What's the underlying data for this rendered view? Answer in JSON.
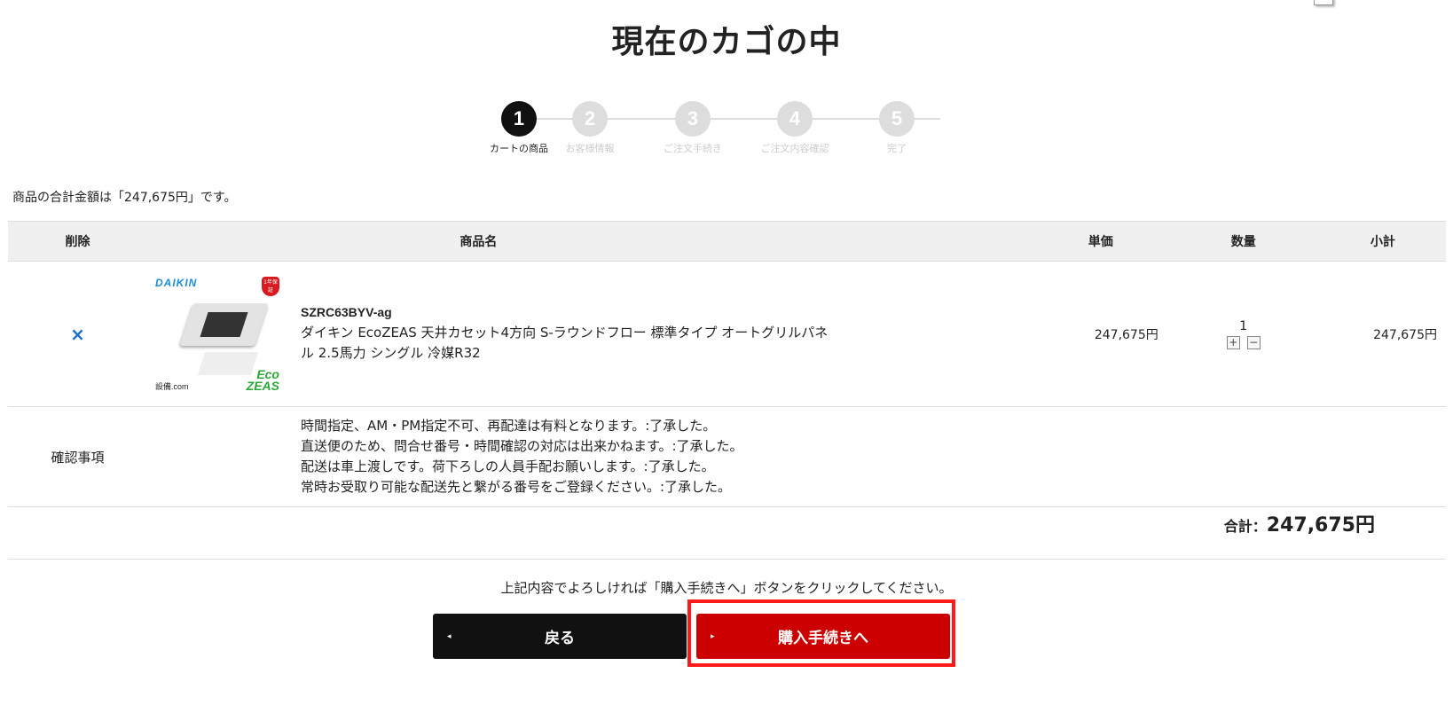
{
  "page": {
    "title": "現在のカゴの中"
  },
  "steps": [
    {
      "number": "1",
      "label": "カートの商品",
      "active": true
    },
    {
      "number": "2",
      "label": "お客様情報",
      "active": false
    },
    {
      "number": "3",
      "label": "ご注文手続き",
      "active": false
    },
    {
      "number": "4",
      "label": "ご注文内容確認",
      "active": false
    },
    {
      "number": "5",
      "label": "完了",
      "active": false
    }
  ],
  "summary_text": "商品の合計金額は「247,675円」です。",
  "table": {
    "headers": {
      "delete": "削除",
      "name": "商品名",
      "price": "単価",
      "qty": "数量",
      "subtotal": "小計"
    },
    "item": {
      "delete_icon": "×",
      "image": {
        "brand": "DAIKIN",
        "badge": "1年保証",
        "store": "設備.com",
        "eco_top": "Eco",
        "eco_bottom": "ZEAS"
      },
      "code": "SZRC63BYV-ag",
      "name": "ダイキン EcoZEAS 天井カセット4方向 S-ラウンドフロー 標準タイプ オートグリルパネル 2.5馬力 シングル 冷媒R32",
      "unit_price": "247,675円",
      "quantity": "1",
      "plus": "+",
      "minus": "−",
      "subtotal": "247,675円"
    },
    "confirm": {
      "label": "確認事項",
      "lines": [
        "時間指定、AM・PM指定不可、再配達は有料となります。:了承した。",
        "直送便のため、問合せ番号・時間確認の対応は出来かねます。:了承した。",
        "配送は車上渡しです。荷下ろしの人員手配お願いします。:了承した。",
        "常時お受取り可能な配送先と繋がる番号をご登録ください。:了承した。"
      ]
    }
  },
  "total": {
    "label": "合計：",
    "amount": "247,675円"
  },
  "note": "上記内容でよろしければ「購入手続きへ」ボタンをクリックしてください。",
  "buttons": {
    "back": "戻る",
    "next": "購入手続きへ",
    "back_arrow": "◂",
    "next_arrow": "▸"
  },
  "colors": {
    "accent": "#cc0000",
    "dark": "#111111",
    "link": "#1a6fc9",
    "highlight": "#ff1a1a"
  }
}
